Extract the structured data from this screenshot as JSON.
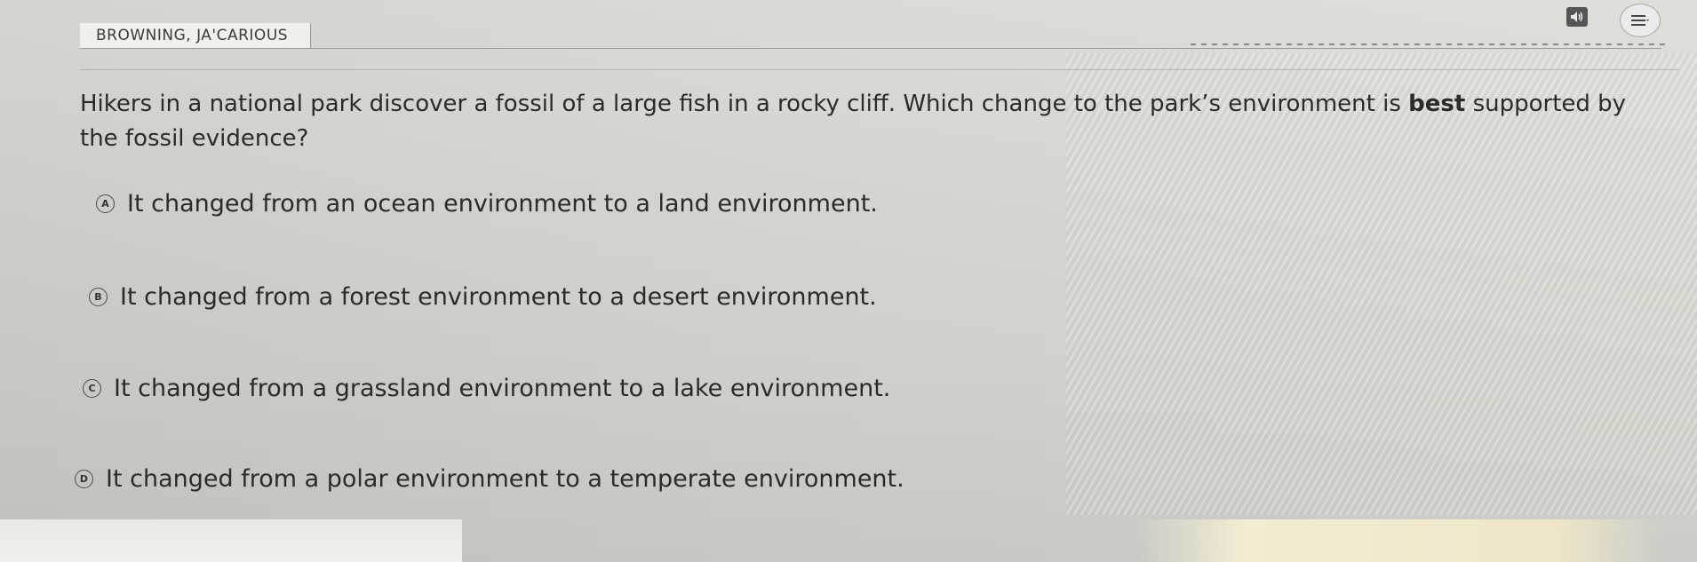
{
  "header": {
    "student_name": "BROWNING, JA'CARIOUS"
  },
  "question": {
    "text_before": "Hikers in a national park discover a fossil of a large fish in a rocky cliff. Which change to the park’s environment is ",
    "emphasis": "best",
    "text_after": " supported by the fossil evidence?"
  },
  "options": [
    {
      "letter": "A",
      "text": "It changed from an ocean environment to a land environment."
    },
    {
      "letter": "B",
      "text": "It changed from a forest environment to a desert environment."
    },
    {
      "letter": "C",
      "text": "It changed from a grassland environment to a lake environment."
    },
    {
      "letter": "D",
      "text": "It changed from a polar environment to a temperate environment."
    }
  ],
  "icons": {
    "audio": "speaker-icon",
    "menu": "hamburger-menu-icon"
  },
  "colors": {
    "text": "#2b2b2b",
    "background": "#d6d7d2"
  }
}
